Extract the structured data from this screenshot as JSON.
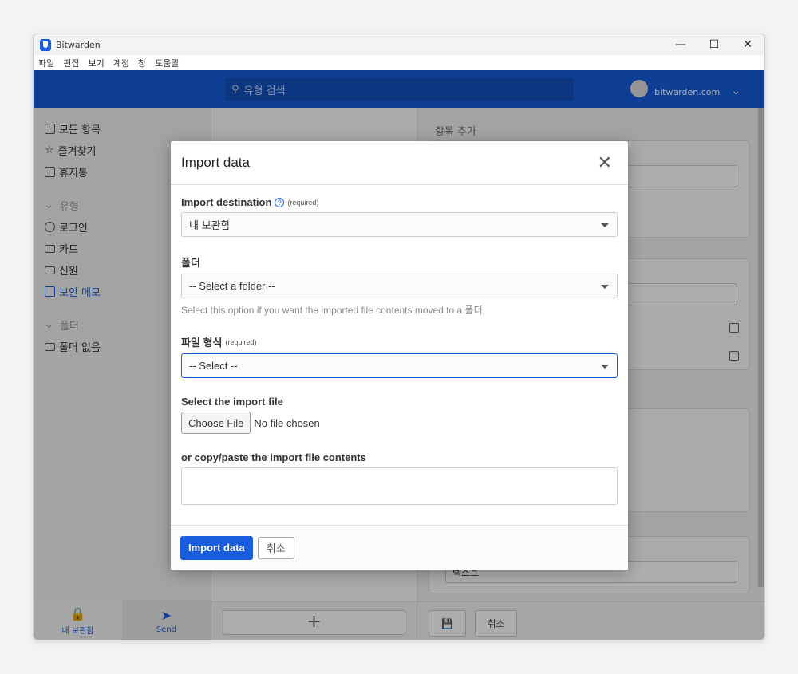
{
  "window": {
    "title": "Bitwarden",
    "minimize": "—",
    "maximize": "☐",
    "close": "✕"
  },
  "menu": [
    "파일",
    "편집",
    "보기",
    "계정",
    "창",
    "도움말"
  ],
  "header": {
    "search_placeholder": "유형 검색",
    "account": "bitwarden.com"
  },
  "sidebar": {
    "items": [
      {
        "label": "모든 항목",
        "icon": "grid-icon"
      },
      {
        "label": "즐겨찾기",
        "icon": "star-icon"
      },
      {
        "label": "휴지통",
        "icon": "trash-icon"
      }
    ],
    "types_heading": "유형",
    "types": [
      {
        "label": "로그인",
        "icon": "globe-icon"
      },
      {
        "label": "카드",
        "icon": "card-icon"
      },
      {
        "label": "신원",
        "icon": "id-icon"
      },
      {
        "label": "보안 메모",
        "icon": "note-icon",
        "active": true
      }
    ],
    "folders_heading": "폴더",
    "folders": [
      {
        "label": "폴더 없음",
        "icon": "folder-icon"
      }
    ],
    "bottom_nav": [
      {
        "label": "내 보관함",
        "icon": "lock-icon"
      },
      {
        "label": "Send",
        "icon": "send-icon"
      }
    ]
  },
  "middle": {
    "add_label": "+"
  },
  "right": {
    "title": "항목 추가",
    "note_type": "텍스트",
    "cancel": "취소"
  },
  "modal": {
    "title": "Import data",
    "destination_label": "Import destination",
    "required": "(required)",
    "destination_value": "내 보관함",
    "folder_label": "폴더",
    "folder_value": "-- Select a folder --",
    "folder_hint": "Select this option if you want the imported file contents moved to a 폴더",
    "format_label": "파일 형식",
    "format_value": "-- Select --",
    "file_label": "Select the import file",
    "choose_file": "Choose File",
    "no_file": "No file chosen",
    "paste_label": "or copy/paste the import file contents",
    "submit": "Import data",
    "cancel": "취소"
  },
  "colors": {
    "accent": "#175ddc"
  }
}
